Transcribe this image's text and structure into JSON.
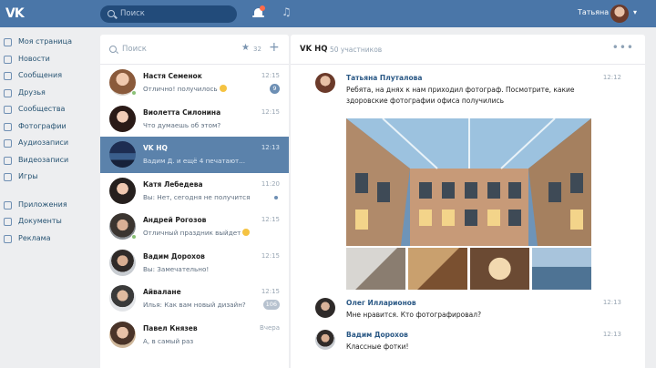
{
  "topbar": {
    "logo": "VK",
    "search_placeholder": "Поиск",
    "user_name": "Татьяна"
  },
  "leftnav": {
    "items": [
      {
        "label": "Моя страница",
        "icon": "home-icon"
      },
      {
        "label": "Новости",
        "icon": "news-icon"
      },
      {
        "label": "Сообщения",
        "icon": "messages-icon"
      },
      {
        "label": "Друзья",
        "icon": "friends-icon"
      },
      {
        "label": "Сообщества",
        "icon": "communities-icon"
      },
      {
        "label": "Фотографии",
        "icon": "photos-icon"
      },
      {
        "label": "Аудиозаписи",
        "icon": "audio-icon"
      },
      {
        "label": "Видеозаписи",
        "icon": "video-icon"
      },
      {
        "label": "Игры",
        "icon": "games-icon"
      }
    ],
    "items2": [
      {
        "label": "Приложения",
        "icon": "apps-icon"
      },
      {
        "label": "Документы",
        "icon": "documents-icon"
      },
      {
        "label": "Реклама",
        "icon": "ads-icon"
      }
    ]
  },
  "chatlist": {
    "search_placeholder": "Поиск",
    "star_count": "32",
    "chats": [
      {
        "name": "Настя Семенок",
        "snippet": "Отлично! получилось",
        "time": "12:15",
        "badge": "9",
        "online": true,
        "emoji": true
      },
      {
        "name": "Виолетта Силонина",
        "snippet": "Что думаешь об этом?",
        "time": "12:15",
        "badge": "",
        "online": false
      },
      {
        "name": "VK HQ",
        "snippet": "Вадим Д. и ещё 4 печатают...",
        "time": "12:13",
        "badge": "",
        "online": false
      },
      {
        "name": "Катя Лебедева",
        "snippet": "Вы: Нет, сегодня не получится",
        "time": "11:20",
        "badge": "",
        "online": false,
        "dot": true
      },
      {
        "name": "Андрей Рогозов",
        "snippet": "Отличный праздник выйдет",
        "time": "12:15",
        "badge": "",
        "online": true,
        "emoji": true
      },
      {
        "name": "Вадим Дорохов",
        "snippet": "Вы: Замечательно!",
        "time": "12:15",
        "badge": "",
        "online": false
      },
      {
        "name": "Айвалане",
        "snippet": "Илья: Как вам новый дизайн?",
        "time": "12:15",
        "badge": "106",
        "online": false
      },
      {
        "name": "Павел Князев",
        "snippet": "А, в самый раз",
        "time": "Вчера",
        "badge": "",
        "online": false
      }
    ]
  },
  "chatwin": {
    "title": "VK HQ",
    "members": "50 участников",
    "messages": [
      {
        "name": "Татьяна Плуталова",
        "text": "Ребята, на днях к нам приходил фотограф. Посмотрите, какие здоровские фотографии офиса получились",
        "time": "12:12"
      },
      {
        "name": "Олег Илларионов",
        "text": "Мне нравится. Кто фотографировал?",
        "time": "12:13"
      },
      {
        "name": "Вадим Дорохов",
        "text": "Классные фотки!",
        "time": "12:13"
      }
    ]
  },
  "colors": {
    "header": "#4a76a8",
    "active_row": "#5b82ab",
    "link": "#2a5885",
    "background": "#edeef0"
  }
}
